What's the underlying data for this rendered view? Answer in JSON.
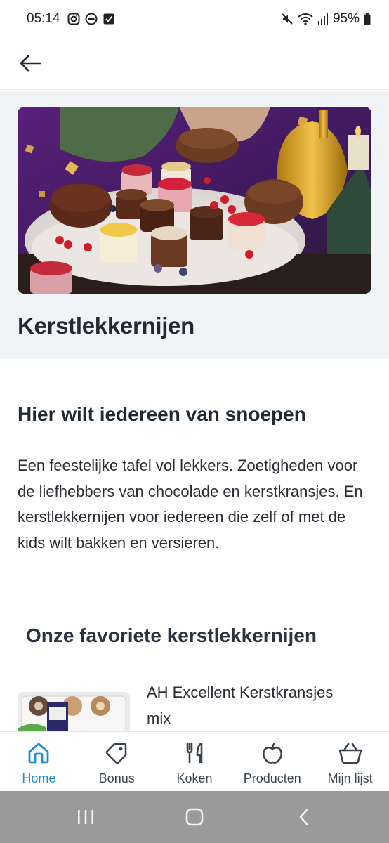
{
  "status_bar": {
    "time": "05:14",
    "battery": "95%",
    "left_icons": [
      "instagram-icon",
      "do-not-disturb-icon",
      "checkbox-icon"
    ],
    "right_icons": [
      "mute-icon",
      "wifi-icon",
      "signal-icon",
      "battery-icon"
    ]
  },
  "header": {
    "back_icon": "back-arrow-icon"
  },
  "hero": {
    "title": "Kerstlekkernijen"
  },
  "content": {
    "heading": "Hier wilt iedereen van snoepen",
    "intro": "Een feestelijke tafel vol lekkers. Zoetigheden voor de liefhebbers van chocolade en kerstkransjes. En kerstlekkernijen voor iedereen die zelf of met de kids wilt bakken en versieren.",
    "favorites_heading": "Onze favoriete kerstlekkernijen",
    "products": [
      {
        "name": "AH Excellent Kerstkransjes mix"
      }
    ]
  },
  "bottom_nav": {
    "items": [
      {
        "label": "Home",
        "icon": "home-icon",
        "active": true
      },
      {
        "label": "Bonus",
        "icon": "tag-icon",
        "active": false
      },
      {
        "label": "Koken",
        "icon": "cutlery-icon",
        "active": false
      },
      {
        "label": "Producten",
        "icon": "apple-icon",
        "active": false
      },
      {
        "label": "Mijn lijst",
        "icon": "basket-icon",
        "active": false
      }
    ]
  },
  "system_nav": {
    "buttons": [
      "recents-icon",
      "home-circle-icon",
      "back-chevron-icon"
    ]
  },
  "colors": {
    "accent": "#1d8fcf",
    "text": "#1f2a36",
    "hero_bg": "#f1f4f7"
  }
}
